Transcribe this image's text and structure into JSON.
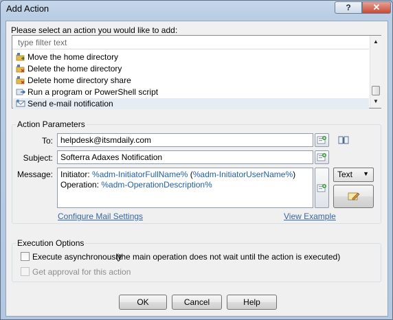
{
  "window": {
    "title": "Add Action",
    "help_glyph": "?",
    "close_glyph": "✕"
  },
  "prompt": "Please select an action you would like to add:",
  "action_list": {
    "filter_placeholder": "type filter text",
    "items": [
      {
        "label": "Move the home directory",
        "icon": "folder-move-icon",
        "selected": false
      },
      {
        "label": "Delete the home directory",
        "icon": "folder-delete-icon",
        "selected": false
      },
      {
        "label": "Delete home directory share",
        "icon": "folder-share-delete-icon",
        "selected": false
      },
      {
        "label": "Run a program or PowerShell script",
        "icon": "run-script-icon",
        "selected": false
      },
      {
        "label": "Send e-mail notification",
        "icon": "email-icon",
        "selected": true
      }
    ]
  },
  "action_parameters": {
    "group_title": "Action Parameters",
    "to_label": "To:",
    "to_value": "helpdesk@itsmdaily.com",
    "subject_label": "Subject:",
    "subject_value": "Softerra Adaxes Notification",
    "message_label": "Message:",
    "message_line1_prefix": "Initiator: ",
    "message_line1_var1": "%adm-InitiatorFullName%",
    "message_line1_mid": " (",
    "message_line1_var2": "%adm-InitiatorUserName%",
    "message_line1_suffix": ")",
    "message_line2_prefix": "Operation: ",
    "message_line2_var": "%adm-OperationDescription%",
    "format_value": "Text",
    "configure_mail_link": "Configure Mail Settings",
    "view_example_link": "View Example"
  },
  "execution_options": {
    "group_title": "Execution Options",
    "execute_async_label": "Execute asynchronously",
    "execute_async_note": "(the main operation does not wait until the action is executed)",
    "execute_async_checked": false,
    "get_approval_label": "Get approval for this action",
    "get_approval_checked": false,
    "get_approval_enabled": false
  },
  "buttons": {
    "ok": "OK",
    "cancel": "Cancel",
    "help": "Help"
  },
  "colors": {
    "accent_link": "#3465a4",
    "variable_text": "#1f5fa8",
    "window_frame": "#b9cde4"
  }
}
